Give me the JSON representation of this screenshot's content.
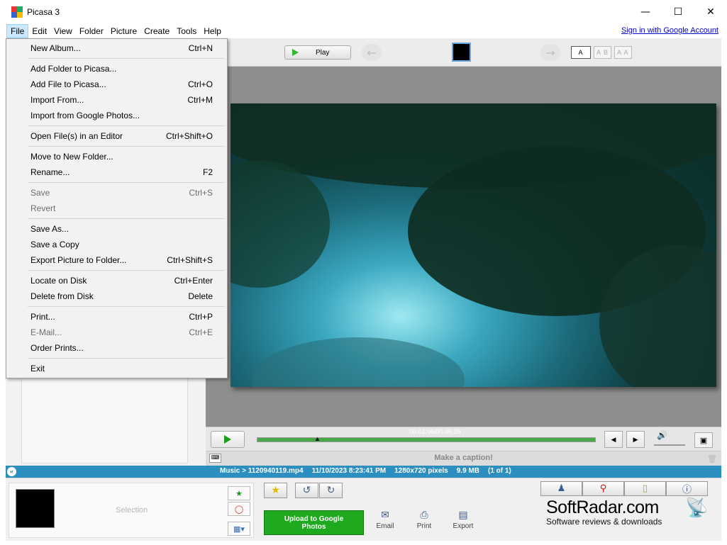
{
  "window": {
    "title": "Picasa 3",
    "minimize_icon": "minimize-icon",
    "maximize_icon": "maximize-icon",
    "close_icon": "close-icon"
  },
  "menu": {
    "items": [
      "File",
      "Edit",
      "View",
      "Folder",
      "Picture",
      "Create",
      "Tools",
      "Help"
    ],
    "sign_in": "Sign in with Google Account"
  },
  "toolbar": {
    "play_label": "Play",
    "caption_modes": [
      "A",
      "A B",
      "A A"
    ]
  },
  "player": {
    "time": "00:01:06/00:06:36",
    "volume_icon": "speaker-icon"
  },
  "caption": {
    "placeholder": "Make a caption!"
  },
  "status": {
    "path": "Music > 1120940119.mp4",
    "datetime": "11/10/2023 8:23:41 PM",
    "dimensions": "1280x720 pixels",
    "size": "9.9 MB",
    "position": "(1 of 1)"
  },
  "tray": {
    "selection_label": "Selection",
    "upload_label_line1": "Upload to Google",
    "upload_label_line2": "Photos",
    "email_label": "Email",
    "print_label": "Print",
    "export_label": "Export"
  },
  "watermark": {
    "name": "SoftRadar.com",
    "tagline": "Software reviews & downloads"
  },
  "file_menu": {
    "groups": [
      [
        {
          "label": "New Album...",
          "shortcut": "Ctrl+N",
          "enabled": true
        }
      ],
      [
        {
          "label": "Add Folder to Picasa...",
          "shortcut": "",
          "enabled": true
        },
        {
          "label": "Add File to Picasa...",
          "shortcut": "Ctrl+O",
          "enabled": true
        },
        {
          "label": "Import From...",
          "shortcut": "Ctrl+M",
          "enabled": true
        },
        {
          "label": "Import from Google Photos...",
          "shortcut": "",
          "enabled": true
        }
      ],
      [
        {
          "label": "Open File(s) in an Editor",
          "shortcut": "Ctrl+Shift+O",
          "enabled": true
        }
      ],
      [
        {
          "label": "Move to New Folder...",
          "shortcut": "",
          "enabled": true
        },
        {
          "label": "Rename...",
          "shortcut": "F2",
          "enabled": true
        }
      ],
      [
        {
          "label": "Save",
          "shortcut": "Ctrl+S",
          "enabled": false
        },
        {
          "label": "Revert",
          "shortcut": "",
          "enabled": false
        }
      ],
      [
        {
          "label": "Save As...",
          "shortcut": "",
          "enabled": true
        },
        {
          "label": "Save a Copy",
          "shortcut": "",
          "enabled": true
        },
        {
          "label": "Export Picture to Folder...",
          "shortcut": "Ctrl+Shift+S",
          "enabled": true
        }
      ],
      [
        {
          "label": "Locate on Disk",
          "shortcut": "Ctrl+Enter",
          "enabled": true
        },
        {
          "label": "Delete from Disk",
          "shortcut": "Delete",
          "enabled": true
        }
      ],
      [
        {
          "label": "Print...",
          "shortcut": "Ctrl+P",
          "enabled": true
        },
        {
          "label": "E-Mail...",
          "shortcut": "Ctrl+E",
          "enabled": false
        },
        {
          "label": "Order Prints...",
          "shortcut": "",
          "enabled": true
        }
      ],
      [
        {
          "label": "Exit",
          "shortcut": "",
          "enabled": true
        }
      ]
    ]
  },
  "colors": {
    "status_bar": "#2d8fbf",
    "upload_button": "#1ea91e",
    "menu_highlight": "#cce8ff"
  }
}
